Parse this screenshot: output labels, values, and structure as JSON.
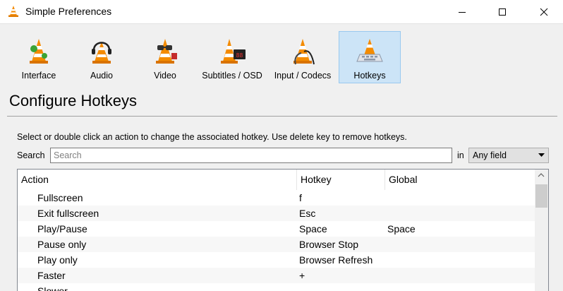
{
  "window": {
    "title": "Simple Preferences",
    "icon": "vlc-cone-icon"
  },
  "categories": [
    {
      "label": "Interface",
      "icon": "interface-cone-icon",
      "selected": false
    },
    {
      "label": "Audio",
      "icon": "audio-cone-headphones-icon",
      "selected": false
    },
    {
      "label": "Video",
      "icon": "video-cone-glasses-icon",
      "selected": false
    },
    {
      "label": "Subtitles / OSD",
      "icon": "subtitles-cone-display-icon",
      "selected": false
    },
    {
      "label": "Input / Codecs",
      "icon": "input-cone-cable-icon",
      "selected": false
    },
    {
      "label": "Hotkeys",
      "icon": "hotkeys-cone-keyboard-icon",
      "selected": true
    }
  ],
  "panel": {
    "title": "Configure Hotkeys",
    "instructions": "Select or double click an action to change the associated hotkey. Use delete key to remove hotkeys."
  },
  "search": {
    "label": "Search",
    "placeholder": "Search",
    "value": "",
    "in_label": "in",
    "field_selected": "Any field"
  },
  "table": {
    "columns": [
      "Action",
      "Hotkey",
      "Global"
    ],
    "rows": [
      {
        "action": "Fullscreen",
        "hotkey": "f",
        "global": ""
      },
      {
        "action": "Exit fullscreen",
        "hotkey": "Esc",
        "global": ""
      },
      {
        "action": "Play/Pause",
        "hotkey": "Space",
        "global": "Space"
      },
      {
        "action": "Pause only",
        "hotkey": "Browser Stop",
        "global": ""
      },
      {
        "action": "Play only",
        "hotkey": "Browser Refresh",
        "global": ""
      },
      {
        "action": "Faster",
        "hotkey": "+",
        "global": ""
      },
      {
        "action": "Slower",
        "hotkey": "",
        "global": ""
      }
    ]
  },
  "colors": {
    "selected_bg": "#cce4f7",
    "selected_border": "#99c9ef",
    "cone_orange": "#f48b00"
  }
}
